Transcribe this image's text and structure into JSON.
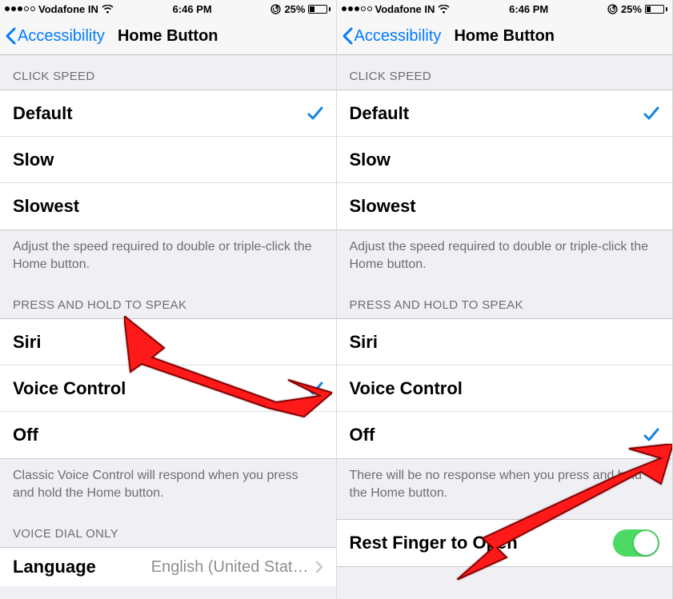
{
  "status": {
    "carrier": "Vodafone IN",
    "time": "6:46 PM",
    "battery_pct": "25%"
  },
  "nav": {
    "back_label": "Accessibility",
    "title": "Home Button"
  },
  "sections": {
    "click_speed": {
      "header": "CLICK SPEED",
      "options": {
        "default": "Default",
        "slow": "Slow",
        "slowest": "Slowest"
      },
      "footer": "Adjust the speed required to double or triple-click the Home button."
    },
    "press_hold": {
      "header": "PRESS AND HOLD TO SPEAK",
      "options": {
        "siri": "Siri",
        "voice_control": "Voice Control",
        "off": "Off"
      },
      "footer_vc": "Classic Voice Control will respond when you press and hold the Home button.",
      "footer_off": "There will be no response when you press and hold the Home button."
    },
    "voice_dial": {
      "header": "VOICE DIAL ONLY",
      "language_label": "Language",
      "language_value": "English (United Stat…"
    },
    "rest_finger": {
      "label": "Rest Finger to Open"
    }
  }
}
